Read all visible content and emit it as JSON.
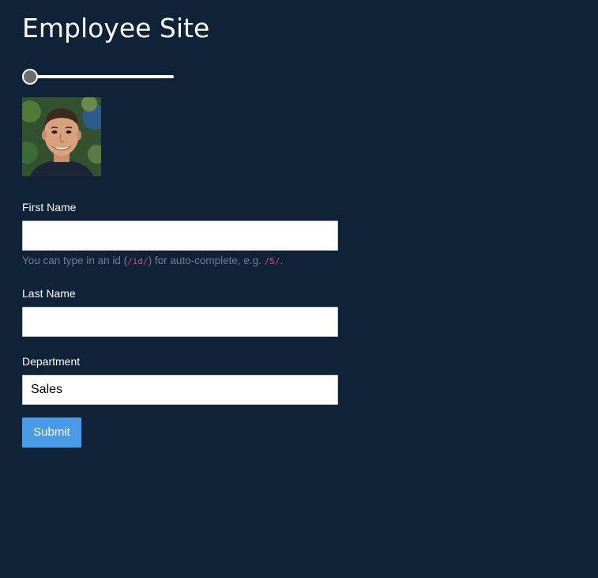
{
  "page": {
    "title": "Employee Site"
  },
  "slider": {
    "value_fraction": 0.0
  },
  "avatar": {
    "icon": "employee-photo"
  },
  "form": {
    "first_name": {
      "label": "First Name",
      "value": "",
      "placeholder": ""
    },
    "help": {
      "prefix": "You can type in an id (",
      "code1": "/id/",
      "middle": ") for auto-complete, e.g. ",
      "code2": "/5/",
      "suffix": "."
    },
    "last_name": {
      "label": "Last Name",
      "value": "",
      "placeholder": ""
    },
    "department": {
      "label": "Department",
      "value": "Sales"
    },
    "submit_label": "Submit"
  },
  "colors": {
    "background": "#0f2238",
    "accent": "#4a9be6",
    "help_text": "#6d7e90",
    "code_text": "#e0457b"
  }
}
